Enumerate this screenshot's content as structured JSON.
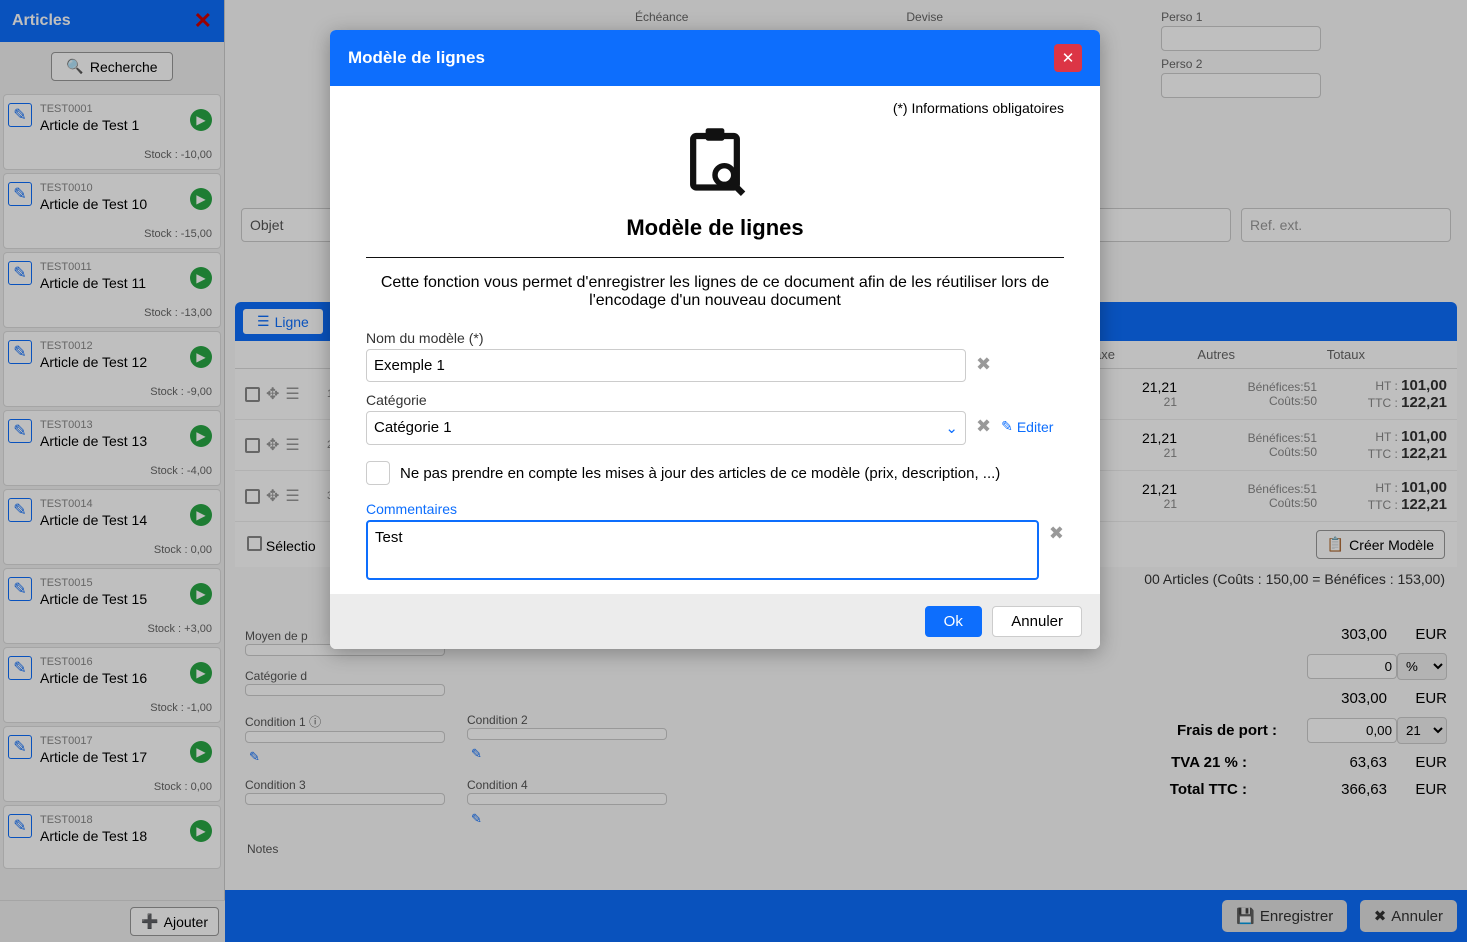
{
  "sidebar": {
    "title": "Articles",
    "search": "Recherche",
    "items": [
      {
        "code": "TEST0001",
        "name": "Article de Test 1",
        "stock": "Stock : -10,00"
      },
      {
        "code": "TEST0010",
        "name": "Article de Test 10",
        "stock": "Stock : -15,00"
      },
      {
        "code": "TEST0011",
        "name": "Article de Test 11",
        "stock": "Stock : -13,00"
      },
      {
        "code": "TEST0012",
        "name": "Article de Test 12",
        "stock": "Stock : -9,00"
      },
      {
        "code": "TEST0013",
        "name": "Article de Test 13",
        "stock": "Stock : -4,00"
      },
      {
        "code": "TEST0014",
        "name": "Article de Test 14",
        "stock": "Stock : 0,00"
      },
      {
        "code": "TEST0015",
        "name": "Article de Test 15",
        "stock": "Stock : +3,00"
      },
      {
        "code": "TEST0016",
        "name": "Article de Test 16",
        "stock": "Stock : -1,00"
      },
      {
        "code": "TEST0017",
        "name": "Article de Test 17",
        "stock": "Stock : 0,00"
      },
      {
        "code": "TEST0018",
        "name": "Article de Test 18",
        "stock": ""
      }
    ],
    "add": "Ajouter"
  },
  "top": {
    "echeance": "Échéance",
    "devise": "Devise",
    "perso1": "Perso 1",
    "perso2": "Perso 2",
    "objet": "Objet",
    "refext": "Ref. ext."
  },
  "tab": {
    "label": "Ligne"
  },
  "table": {
    "headers": {
      "taxe": "Taxe",
      "autres": "Autres",
      "totaux": "Totaux"
    },
    "rows": [
      {
        "num": "1",
        "taxe": "21,21",
        "taxe2": "21",
        "benef": "Bénéfices:51",
        "couts": "Coûts:50",
        "ht": "HT : ",
        "htVal": "101,00",
        "ttc": "TTC : ",
        "ttcVal": "122,21"
      },
      {
        "num": "2",
        "taxe": "21,21",
        "taxe2": "21",
        "benef": "Bénéfices:51",
        "couts": "Coûts:50",
        "ht": "HT : ",
        "htVal": "101,00",
        "ttc": "TTC : ",
        "ttcVal": "122,21"
      },
      {
        "num": "3",
        "taxe": "21,21",
        "taxe2": "21",
        "benef": "Bénéfices:51",
        "couts": "Coûts:50",
        "ht": "HT : ",
        "htVal": "101,00",
        "ttc": "TTC : ",
        "ttcVal": "122,21"
      }
    ],
    "select_prefix": "Sélectio",
    "create_model": "Créer Modèle",
    "stats": "00 Articles (Coûts : 150,00 = Bénéfices : 153,00)"
  },
  "payment": {
    "moyen": "Moyen de p",
    "categorie": "Catégorie d",
    "cond1": "Condition 1",
    "cond2": "Condition 2",
    "cond3": "Condition 3",
    "cond4": "Condition 4"
  },
  "totals": {
    "r1": {
      "val": "303,00",
      "cur": "EUR"
    },
    "r2": {
      "val": "0",
      "unit": "%"
    },
    "r3": {
      "val": "303,00",
      "cur": "EUR"
    },
    "frais": {
      "label": "Frais de port :",
      "val": "0,00",
      "sel": "21"
    },
    "tva": {
      "label": "TVA 21 % :",
      "val": "63,63",
      "cur": "EUR"
    },
    "ttc": {
      "label": "Total TTC :",
      "val": "366,63",
      "cur": "EUR"
    }
  },
  "notes": "Notes",
  "footer": {
    "save": "Enregistrer",
    "cancel": "Annuler"
  },
  "modal": {
    "header": "Modèle de lignes",
    "required": "(*) Informations obligatoires",
    "title": "Modèle de lignes",
    "desc": "Cette fonction vous permet d'enregistrer les lignes de ce document afin de les réutiliser lors de l'encodage d'un nouveau document",
    "name_label": "Nom du modèle (*)",
    "name_val": "Exemple 1",
    "cat_label": "Catégorie",
    "cat_val": "Catégorie 1",
    "editer": "Editer",
    "check_label": "Ne pas prendre en compte les mises à jour des articles de ce modèle (prix, description, ...)",
    "comments_label": "Commentaires",
    "comments_val": "Test",
    "ok": "Ok",
    "cancel": "Annuler"
  }
}
